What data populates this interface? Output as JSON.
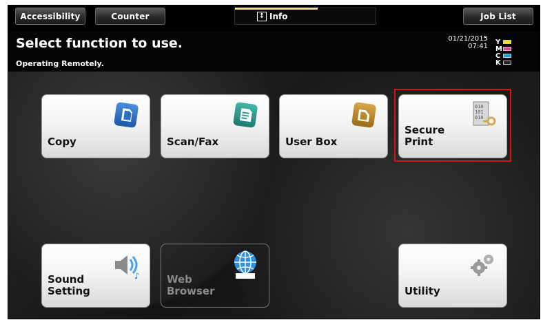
{
  "topbar": {
    "accessibility_label": "Accessibility",
    "counter_label": "Counter",
    "info_label": "Info",
    "job_list_label": "Job List"
  },
  "status": {
    "title": "Select function to use.",
    "subtitle": "Operating Remotely.",
    "date": "01/21/2015",
    "time": "07:41",
    "toner": [
      {
        "label": "Y",
        "color": "#f2e600"
      },
      {
        "label": "M",
        "color": "#e83a9c"
      },
      {
        "label": "C",
        "color": "#1aa0e0"
      },
      {
        "label": "K",
        "color": "#222222"
      }
    ]
  },
  "functions": {
    "copy": "Copy",
    "scan_fax": "Scan/Fax",
    "user_box": "User Box",
    "secure_print_line1": "Secure",
    "secure_print_line2": "Print",
    "sound_setting_line1": "Sound",
    "sound_setting_line2": "Setting",
    "web_browser_line1": "Web",
    "web_browser_line2": "Browser",
    "utility": "Utility"
  },
  "colors": {
    "copy_icon": "#2a6fc1",
    "scan_icon": "#2a9a8a",
    "userbox_icon": "#b88a2a",
    "highlight": "#e01010"
  }
}
